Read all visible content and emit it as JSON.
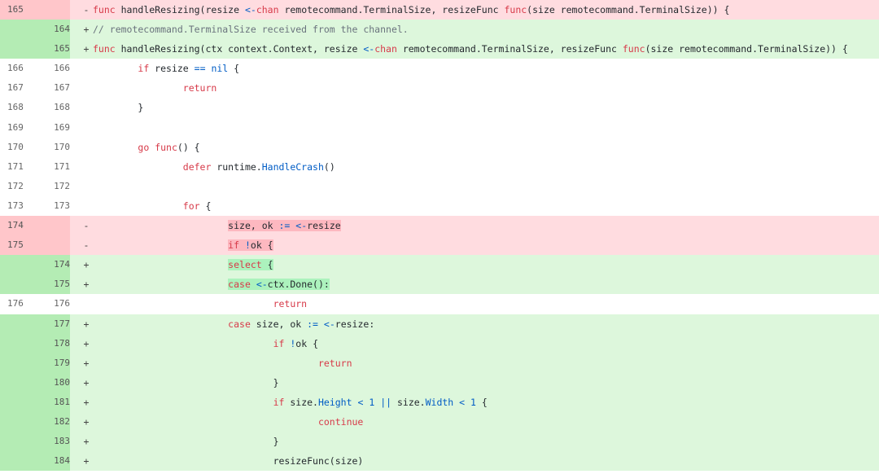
{
  "diff": {
    "rows": [
      {
        "type": "del",
        "old": "165",
        "new": "",
        "marker": "-",
        "indent": 0,
        "tokens": [
          [
            "kw",
            "func"
          ],
          [
            "t",
            " handleResizing(resize "
          ],
          [
            "op",
            "<-"
          ],
          [
            "kw",
            "chan"
          ],
          [
            "t",
            " remotecommand.TerminalSize, resizeFunc "
          ],
          [
            "kw",
            "func"
          ],
          [
            "t",
            "(size remotecommand.TerminalSize)) {"
          ]
        ]
      },
      {
        "type": "add",
        "old": "",
        "new": "164",
        "marker": "+",
        "indent": 0,
        "tokens": [
          [
            "cm",
            "// remotecommand.TerminalSize received from the channel."
          ]
        ]
      },
      {
        "type": "add",
        "old": "",
        "new": "165",
        "marker": "+",
        "indent": 0,
        "tokens": [
          [
            "kw",
            "func"
          ],
          [
            "t",
            " handleResizing(ctx context.Context, resize "
          ],
          [
            "op",
            "<-"
          ],
          [
            "kw",
            "chan"
          ],
          [
            "t",
            " remotecommand.TerminalSize, resizeFunc "
          ],
          [
            "kw",
            "func"
          ],
          [
            "t",
            "(size remotecommand.TerminalSize)) {"
          ]
        ]
      },
      {
        "type": "ctx",
        "old": "166",
        "new": "166",
        "marker": "",
        "indent": 1,
        "tokens": [
          [
            "kw",
            "if"
          ],
          [
            "t",
            " resize "
          ],
          [
            "op",
            "=="
          ],
          [
            "t",
            " "
          ],
          [
            "nil",
            "nil"
          ],
          [
            "t",
            " {"
          ]
        ]
      },
      {
        "type": "ctx",
        "old": "167",
        "new": "167",
        "marker": "",
        "indent": 2,
        "tokens": [
          [
            "kw",
            "return"
          ]
        ]
      },
      {
        "type": "ctx",
        "old": "168",
        "new": "168",
        "marker": "",
        "indent": 1,
        "tokens": [
          [
            "t",
            "}"
          ]
        ]
      },
      {
        "type": "ctx",
        "old": "169",
        "new": "169",
        "marker": "",
        "indent": 0,
        "tokens": []
      },
      {
        "type": "ctx",
        "old": "170",
        "new": "170",
        "marker": "",
        "indent": 1,
        "tokens": [
          [
            "kw",
            "go"
          ],
          [
            "t",
            " "
          ],
          [
            "kw",
            "func"
          ],
          [
            "t",
            "() {"
          ]
        ]
      },
      {
        "type": "ctx",
        "old": "171",
        "new": "171",
        "marker": "",
        "indent": 2,
        "tokens": [
          [
            "kw",
            "defer"
          ],
          [
            "t",
            " runtime."
          ],
          [
            "fn",
            "HandleCrash"
          ],
          [
            "t",
            "()"
          ]
        ]
      },
      {
        "type": "ctx",
        "old": "172",
        "new": "172",
        "marker": "",
        "indent": 0,
        "tokens": []
      },
      {
        "type": "ctx",
        "old": "173",
        "new": "173",
        "marker": "",
        "indent": 2,
        "tokens": [
          [
            "kw",
            "for"
          ],
          [
            "t",
            " {"
          ]
        ]
      },
      {
        "type": "del",
        "old": "174",
        "new": "",
        "marker": "-",
        "indent": 3,
        "hl": true,
        "tokens": [
          [
            "t",
            "size, ok "
          ],
          [
            "op",
            ":="
          ],
          [
            "t",
            " "
          ],
          [
            "op",
            "<-"
          ],
          [
            "t",
            "resize"
          ]
        ]
      },
      {
        "type": "del",
        "old": "175",
        "new": "",
        "marker": "-",
        "indent": 3,
        "hl": true,
        "tokens": [
          [
            "kw",
            "if"
          ],
          [
            "t",
            " "
          ],
          [
            "op",
            "!"
          ],
          [
            "t",
            "ok {"
          ]
        ]
      },
      {
        "type": "add",
        "old": "",
        "new": "174",
        "marker": "+",
        "indent": 3,
        "hl": true,
        "tokens": [
          [
            "kw",
            "select"
          ],
          [
            "t",
            " {"
          ]
        ]
      },
      {
        "type": "add",
        "old": "",
        "new": "175",
        "marker": "+",
        "indent": 3,
        "hl": true,
        "tokens": [
          [
            "kw",
            "case"
          ],
          [
            "t",
            " "
          ],
          [
            "op",
            "<-"
          ],
          [
            "t",
            "ctx.Done():"
          ]
        ]
      },
      {
        "type": "ctx",
        "old": "176",
        "new": "176",
        "marker": "",
        "indent": 4,
        "tokens": [
          [
            "kw",
            "return"
          ]
        ]
      },
      {
        "type": "add",
        "old": "",
        "new": "177",
        "marker": "+",
        "indent": 3,
        "tokens": [
          [
            "kw",
            "case"
          ],
          [
            "t",
            " size, ok "
          ],
          [
            "op",
            ":="
          ],
          [
            "t",
            " "
          ],
          [
            "op",
            "<-"
          ],
          [
            "t",
            "resize:"
          ]
        ]
      },
      {
        "type": "add",
        "old": "",
        "new": "178",
        "marker": "+",
        "indent": 4,
        "tokens": [
          [
            "kw",
            "if"
          ],
          [
            "t",
            " "
          ],
          [
            "op",
            "!"
          ],
          [
            "t",
            "ok {"
          ]
        ]
      },
      {
        "type": "add",
        "old": "",
        "new": "179",
        "marker": "+",
        "indent": 5,
        "tokens": [
          [
            "kw",
            "return"
          ]
        ]
      },
      {
        "type": "add",
        "old": "",
        "new": "180",
        "marker": "+",
        "indent": 4,
        "tokens": [
          [
            "t",
            "}"
          ]
        ]
      },
      {
        "type": "add",
        "old": "",
        "new": "181",
        "marker": "+",
        "indent": 4,
        "tokens": [
          [
            "kw",
            "if"
          ],
          [
            "t",
            " size."
          ],
          [
            "fn",
            "Height"
          ],
          [
            "t",
            " "
          ],
          [
            "op",
            "<"
          ],
          [
            "t",
            " "
          ],
          [
            "nil",
            "1"
          ],
          [
            "t",
            " "
          ],
          [
            "op",
            "||"
          ],
          [
            "t",
            " size."
          ],
          [
            "fn",
            "Width"
          ],
          [
            "t",
            " "
          ],
          [
            "op",
            "<"
          ],
          [
            "t",
            " "
          ],
          [
            "nil",
            "1"
          ],
          [
            "t",
            " {"
          ]
        ]
      },
      {
        "type": "add",
        "old": "",
        "new": "182",
        "marker": "+",
        "indent": 5,
        "tokens": [
          [
            "kw",
            "continue"
          ]
        ]
      },
      {
        "type": "add",
        "old": "",
        "new": "183",
        "marker": "+",
        "indent": 4,
        "tokens": [
          [
            "t",
            "}"
          ]
        ]
      },
      {
        "type": "add",
        "old": "",
        "new": "184",
        "marker": "+",
        "indent": 4,
        "tokens": [
          [
            "t",
            "resizeFunc(size)"
          ]
        ]
      }
    ]
  },
  "colors": {
    "deleted_row": "#ffdce0",
    "added_row": "#ddf7dc",
    "keyword": "#d73a49",
    "operator": "#005cc5",
    "comment": "#6a737d"
  }
}
